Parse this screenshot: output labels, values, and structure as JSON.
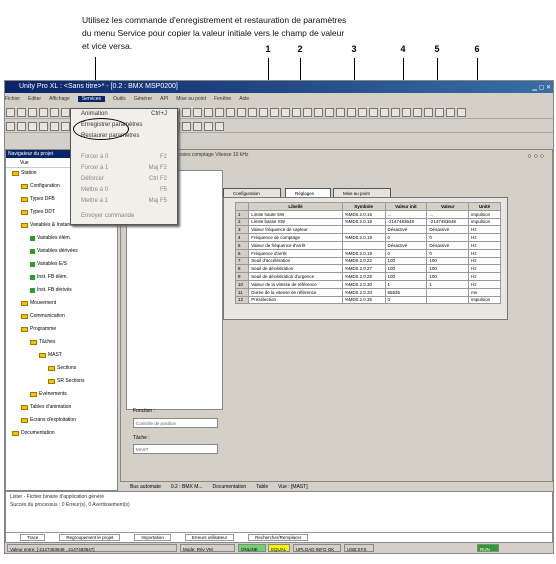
{
  "note": {
    "line1": "Utilisez les commande d'enregistrement et restauration de paramètres",
    "line2": "du menu Service pour copier la valeur initiale vers le champ de valeur",
    "line3": "et vice versa."
  },
  "callouts": [
    "1",
    "2",
    "3",
    "4",
    "5",
    "6"
  ],
  "window": {
    "title": "Unity Pro XL : <Sans titre>* - [0.2 : BMX MSP0200]",
    "menus": [
      "Fichier",
      "Editer",
      "Affichage",
      "Services",
      "Outils",
      "Générer",
      "API",
      "Mise au point",
      "Fenêtre",
      "Aide"
    ],
    "selected_menu": "Services"
  },
  "service_menu": [
    {
      "label": "Animation",
      "shortcut": "Ctrl+J",
      "enabled": true
    },
    {
      "label": "Enregistrer paramètres",
      "shortcut": "",
      "enabled": true
    },
    {
      "label": "Restaurer paramètres",
      "shortcut": "",
      "enabled": true
    },
    {
      "label": "Forcer à 0",
      "shortcut": "F2",
      "enabled": false
    },
    {
      "label": "Forcer à 1",
      "shortcut": "Maj F2",
      "enabled": false
    },
    {
      "label": "Déforcer",
      "shortcut": "Ctrl F2",
      "enabled": false
    },
    {
      "label": "Mettre à 0",
      "shortcut": "F5",
      "enabled": false
    },
    {
      "label": "Mettre à 1",
      "shortcut": "Maj F5",
      "enabled": false
    },
    {
      "label": "Envoyer commande",
      "shortcut": "",
      "enabled": false
    }
  ],
  "browser": {
    "title": "Navigateur du projet",
    "view_label": "Vue",
    "items": [
      {
        "label": "Station",
        "indent": 0,
        "type": "folder"
      },
      {
        "label": "Configuration",
        "indent": 1,
        "type": "folder"
      },
      {
        "label": "Types DFB",
        "indent": 1,
        "type": "folder"
      },
      {
        "label": "Types DDT",
        "indent": 1,
        "type": "folder"
      },
      {
        "label": "Variables & Instances FB",
        "indent": 1,
        "type": "folder"
      },
      {
        "label": "Variables élém.",
        "indent": 2,
        "type": "green"
      },
      {
        "label": "Variables dérivées",
        "indent": 2,
        "type": "green"
      },
      {
        "label": "Variables E/S",
        "indent": 2,
        "type": "green"
      },
      {
        "label": "Inst. FB élém.",
        "indent": 2,
        "type": "green"
      },
      {
        "label": "Inst. FB dérivés",
        "indent": 2,
        "type": "green"
      },
      {
        "label": "Mouvement",
        "indent": 1,
        "type": "folder"
      },
      {
        "label": "Communication",
        "indent": 1,
        "type": "folder"
      },
      {
        "label": "Programme",
        "indent": 1,
        "type": "folder"
      },
      {
        "label": "Tâches",
        "indent": 2,
        "type": "folder"
      },
      {
        "label": "MAST",
        "indent": 3,
        "type": "folder"
      },
      {
        "label": "Sections",
        "indent": 4,
        "type": "folder"
      },
      {
        "label": "SR Sections",
        "indent": 4,
        "type": "folder"
      },
      {
        "label": "Evénements",
        "indent": 2,
        "type": "folder"
      },
      {
        "label": "Tables d'animation",
        "indent": 1,
        "type": "folder"
      },
      {
        "label": "Ecrans d'exploitation",
        "indent": 1,
        "type": "folder"
      },
      {
        "label": "Documentation",
        "indent": 0,
        "type": "folder"
      }
    ]
  },
  "module": {
    "header": "Voies 2 voies comptage Vitesse 10 kHz",
    "tabs": [
      "Configuration",
      "Réglages",
      "Mise au point"
    ],
    "columns": [
      "",
      "Libellé",
      "Symbole",
      "Valeur init",
      "Valeur",
      "Unité"
    ],
    "rows": [
      [
        "1",
        "Limite haute SW",
        "%MD0.2.0.16",
        "...",
        "...",
        "impulsion"
      ],
      [
        "2",
        "Limite basse SW",
        "%MD0.2.0.18",
        "-2147483648",
        "-2147483648",
        "impulsion"
      ],
      [
        "3",
        "Valeur fréquence de capteur",
        "",
        "Désactivé",
        "Désactivé",
        "Hz"
      ],
      [
        "4",
        "Fréquence de comptage",
        "%MD0.2.0.19",
        "0",
        "0",
        "Hz"
      ],
      [
        "5",
        "Valeur de fréquence d'arrêt",
        "",
        "Désactivé",
        "Désactivé",
        "Hz"
      ],
      [
        "6",
        "Fréquence d'arrêt",
        "%MD0.2.0.19",
        "0",
        "0",
        "Hz"
      ],
      [
        "7",
        "Seuil d'accélération",
        "%MD0.2.0.22",
        "100",
        "100",
        "Hz"
      ],
      [
        "8",
        "Seuil de décélération",
        "%MD0.2.0.27",
        "100",
        "100",
        "Hz"
      ],
      [
        "9",
        "Seuil de décélération d'urgence",
        "%MD0.2.0.28",
        "100",
        "100",
        "Hz"
      ],
      [
        "10",
        "Valeur de la vitesse de référence",
        "%MD0.2.0.30",
        "1",
        "1",
        "Hz"
      ],
      [
        "11",
        "Durée de la vitesse de référence",
        "%MD0.2.0.34",
        "65535",
        "",
        "ms"
      ],
      [
        "12",
        "Présélection",
        "%MD0.2.0.35",
        "0",
        "",
        "impulsion"
      ]
    ],
    "function_label": "Fonction :",
    "function_value": "Contrôle de position",
    "task_label": "Tâche :",
    "task_value": "MAST"
  },
  "bottom_tabs": [
    "Bus automate",
    "0.2 : BMX M...",
    "Documentation",
    "Table",
    "Vue : [MAST]"
  ],
  "output": {
    "line1": "Lister - Fichier binaire d'application généré",
    "line2": "Succès du processus : 0 Erreur(s), 0 Avertissement(s)",
    "tabs": [
      "Trace",
      "Regroupement le projet",
      "Importation",
      "Erreurs utilisateur",
      "Rechercher/Remplacer"
    ]
  },
  "status": {
    "left": "Valeur entre: [-2147483648 , 2147483647]",
    "mode": "Mode: Rév VM",
    "online": "ONLINE",
    "conf": "EQUAL",
    "upload": "UPLOAD INFO OK",
    "addr": "USB:SYS",
    "run": "RUN"
  }
}
